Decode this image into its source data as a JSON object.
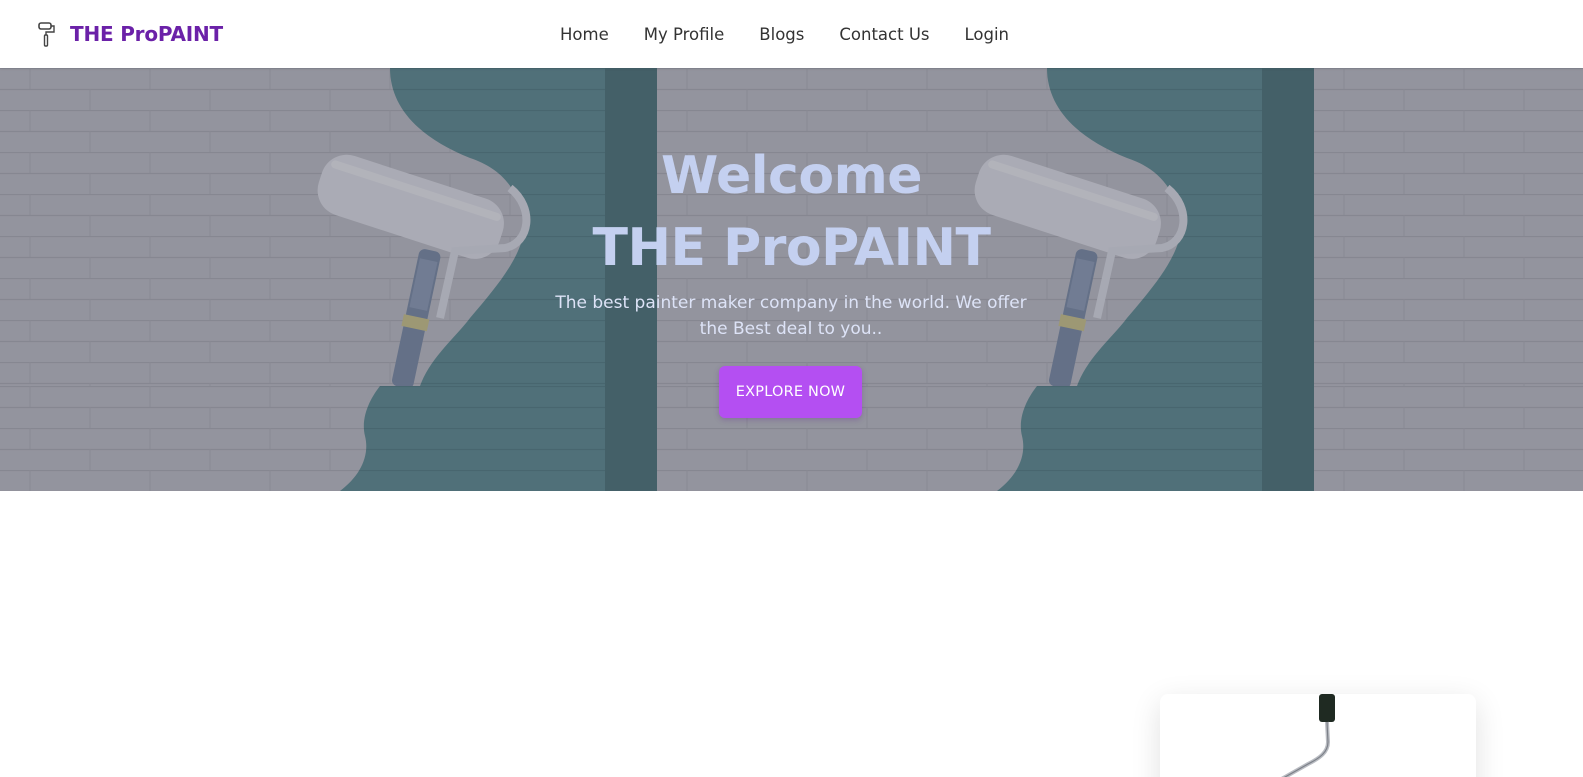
{
  "brand": {
    "name": "THE ProPAINT",
    "icon": "paint-roller-icon",
    "color": "#6b21a8"
  },
  "nav": {
    "items": [
      {
        "label": "Home"
      },
      {
        "label": "My Profile"
      },
      {
        "label": "Blogs"
      },
      {
        "label": "Contact Us"
      },
      {
        "label": "Login"
      }
    ]
  },
  "hero": {
    "title_line1": "Welcome",
    "title_line2": "THE ProPAINT",
    "subtitle": "The best painter maker company in the world. We offer the Best deal to you..",
    "cta_label": "EXPLORE NOW",
    "accent": "#b44ff2"
  }
}
